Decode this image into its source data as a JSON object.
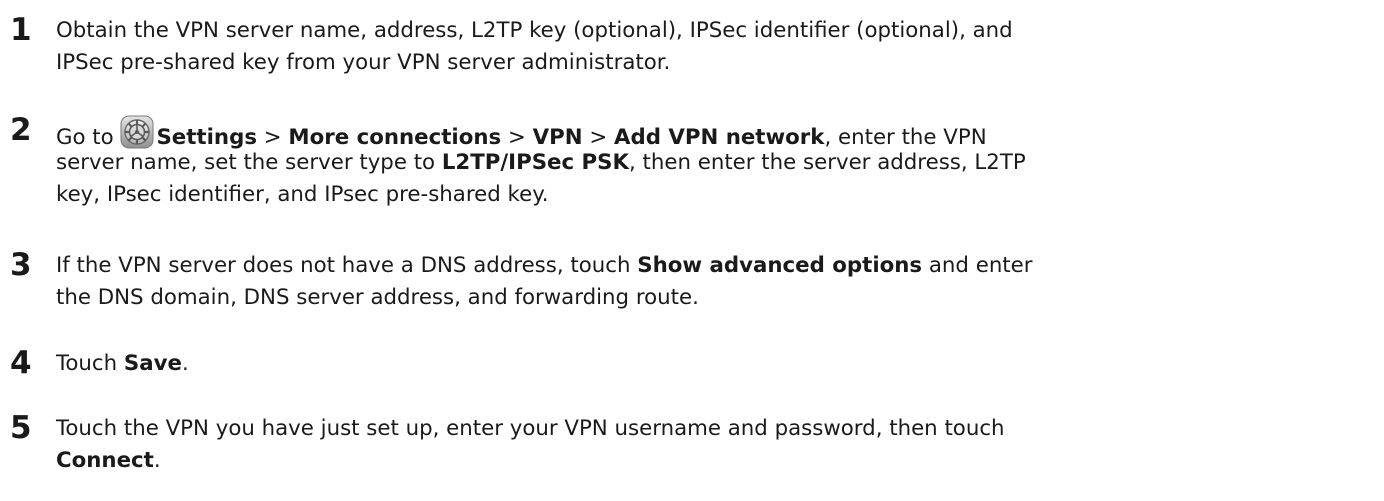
{
  "steps": [
    {
      "number": "1",
      "lines": [
        "Obtain the VPN server name, address, L2TP key (optional), IPSec identifier (optional), and",
        "IPSec pre-shared key from your VPN server administrator."
      ]
    },
    {
      "number": "2",
      "goto": "Go to",
      "settings": "Settings",
      "sep": ">",
      "more_connections": "More connections",
      "vpn": "VPN",
      "add_vpn_network": "Add VPN network",
      "line1_tail": ", enter the VPN",
      "line2_head": "server name, set the server type to",
      "server_type": "L2TP/IPSec PSK",
      "line2_tail": ", then enter the server address, L2TP",
      "line3": "key, IPsec identifier, and IPsec pre-shared key.",
      "icon": "settings-gear-icon"
    },
    {
      "number": "3",
      "line1_head": "If the VPN server does not have a DNS address, touch",
      "show_advanced": "Show advanced options",
      "line1_tail": "and enter",
      "line2": "the DNS domain, DNS server address, and forwarding route."
    },
    {
      "number": "4",
      "head": "Touch",
      "save": "Save",
      "tail": "."
    },
    {
      "number": "5",
      "line1": "Touch the VPN you have just set up, enter your VPN username and password, then touch",
      "connect": "Connect",
      "tail": "."
    }
  ]
}
